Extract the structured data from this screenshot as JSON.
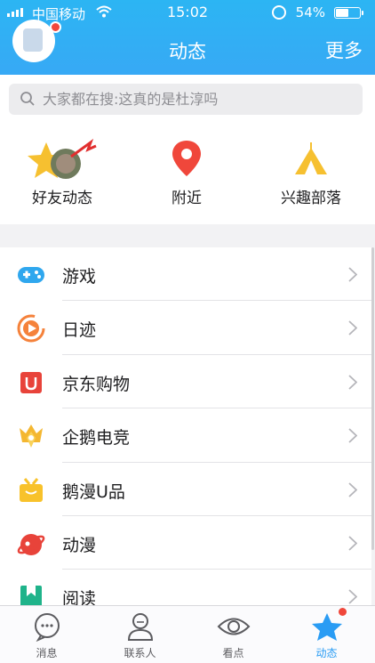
{
  "status_bar": {
    "carrier": "中国移动",
    "time": "15:02",
    "battery_percent": "54%",
    "battery_level": 0.54
  },
  "header": {
    "title": "动态",
    "more_label": "更多"
  },
  "search": {
    "placeholder": "大家都在搜:这真的是杜淳吗"
  },
  "quick_actions": [
    {
      "label": "好友动态",
      "icon": "friend-feed-icon"
    },
    {
      "label": "附近",
      "icon": "location-pin-icon"
    },
    {
      "label": "兴趣部落",
      "icon": "tent-icon"
    }
  ],
  "menu": [
    {
      "label": "游戏",
      "icon": "gamepad-icon"
    },
    {
      "label": "日迹",
      "icon": "play-circle-icon"
    },
    {
      "label": "京东购物",
      "icon": "jd-shopping-icon"
    },
    {
      "label": "企鹅电竞",
      "icon": "esports-crown-icon"
    },
    {
      "label": "鹅漫U品",
      "icon": "gift-box-icon"
    },
    {
      "label": "动漫",
      "icon": "anime-icon"
    },
    {
      "label": "阅读",
      "icon": "book-icon"
    }
  ],
  "tabs": [
    {
      "label": "消息",
      "icon": "message-icon",
      "active": false
    },
    {
      "label": "联系人",
      "icon": "contacts-icon",
      "active": false
    },
    {
      "label": "看点",
      "icon": "eye-icon",
      "active": false
    },
    {
      "label": "动态",
      "icon": "star-icon",
      "active": true
    }
  ],
  "colors": {
    "header": "#2cb5f3",
    "accent": "#2a9cf4",
    "badge": "#f0473b"
  }
}
